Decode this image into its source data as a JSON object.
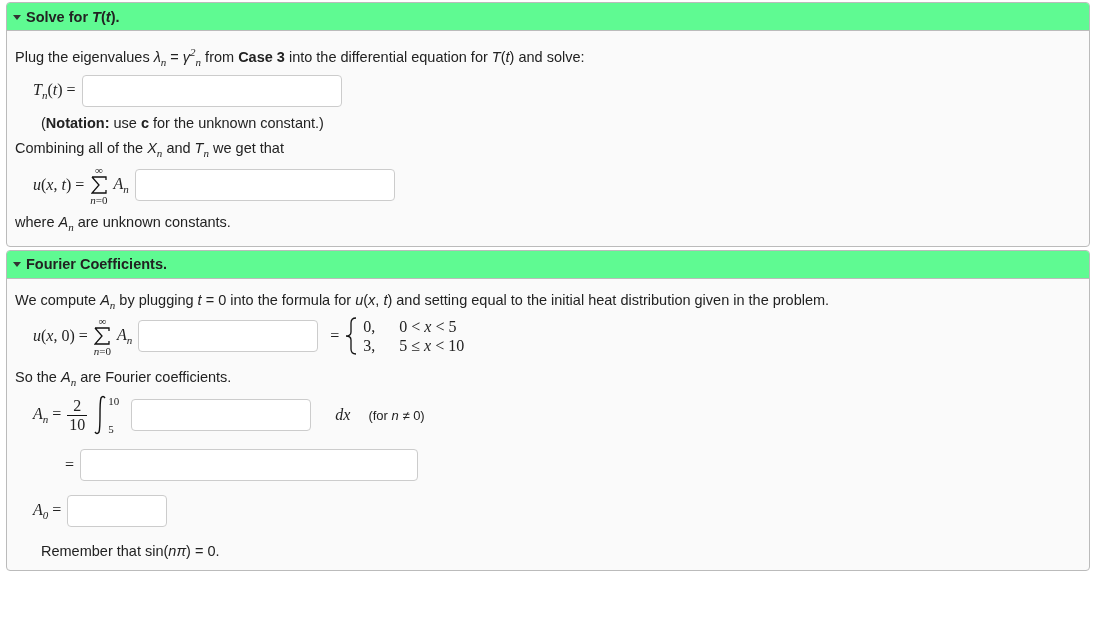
{
  "sections": [
    {
      "title": "Solve for *T*(*t*).",
      "expanded": true,
      "blocks": [
        {
          "kind": "text",
          "text": "Plug the eigenvalues *λ*$_{n}$ = *γ*$^{2}$$_{n}$ from **Case 3** into the differential equation for *T*(*t*) and solve:"
        },
        {
          "kind": "answer",
          "lhs": "*T*$_{n}$(*t*) ="
        },
        {
          "kind": "note",
          "text": "(**Notation:** use **c** for the unknown constant.)"
        },
        {
          "kind": "text",
          "text": "Combining all of the *X*$_{n}$ and *T*$_{n}$ we get that"
        },
        {
          "kind": "sum",
          "lhs": "*u*(*x*, *t*) =",
          "upper": "∞",
          "lower": "*n*=0",
          "term": "*A*$_{n}$"
        },
        {
          "kind": "text",
          "text": "where *A*$_{n}$ are unknown constants."
        }
      ]
    },
    {
      "title": "Fourier Coefficients.",
      "expanded": true,
      "blocks": [
        {
          "kind": "text",
          "text": "We compute *A*$_{n}$ by plugging *t* = 0 into the formula for *u*(*x*, *t*) and setting equal to the initial heat distribution given in the problem."
        },
        {
          "kind": "sum",
          "lhs": "*u*(*x*, 0) =",
          "upper": "∞",
          "lower": "*n*=0",
          "term": "*A*$_{n}$",
          "rhs": "=",
          "cases": [
            {
              "value": "0,",
              "condition": "0 < *x* < 5"
            },
            {
              "value": "3,",
              "condition": "5 ≤ *x* < 10"
            }
          ]
        },
        {
          "kind": "text",
          "text": "So the *A*$_{n}$ are Fourier coefficients."
        },
        {
          "kind": "integral",
          "lhs": "*A*$_{n}$ =",
          "numerator": "2",
          "denominator": "10",
          "upper": "10",
          "lower": "5",
          "after": "*dx*",
          "note": "(for *n* ≠ 0)"
        },
        {
          "kind": "answer",
          "lhs": "="
        },
        {
          "kind": "answer",
          "lhs": "*A*$_{0}$ ="
        },
        {
          "kind": "note",
          "text": "Remember that sin(*nπ*) = 0."
        }
      ]
    }
  ]
}
